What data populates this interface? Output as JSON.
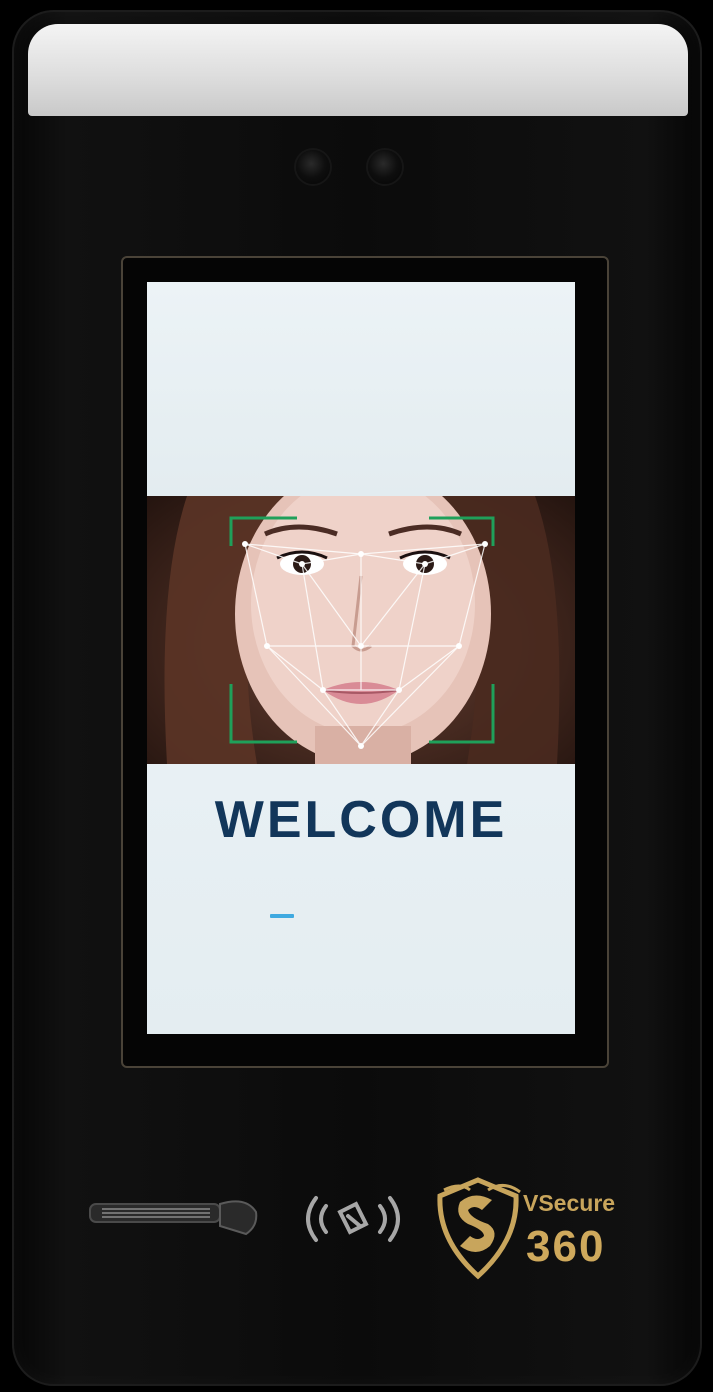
{
  "screen": {
    "welcome_text": "WELCOME"
  },
  "brand": {
    "logo_name_line1": "VSecure",
    "logo_name_line2": "360",
    "gold_color": "#c8a55c"
  },
  "colors": {
    "welcome_text": "#12365a",
    "face_frame": "#1fa05a",
    "input_cursor": "#3fa9e0"
  },
  "icons": [
    "camera-lens-icon",
    "fingerprint-sensor-icon",
    "nfc-card-icon",
    "vsecure-shield-logo"
  ]
}
